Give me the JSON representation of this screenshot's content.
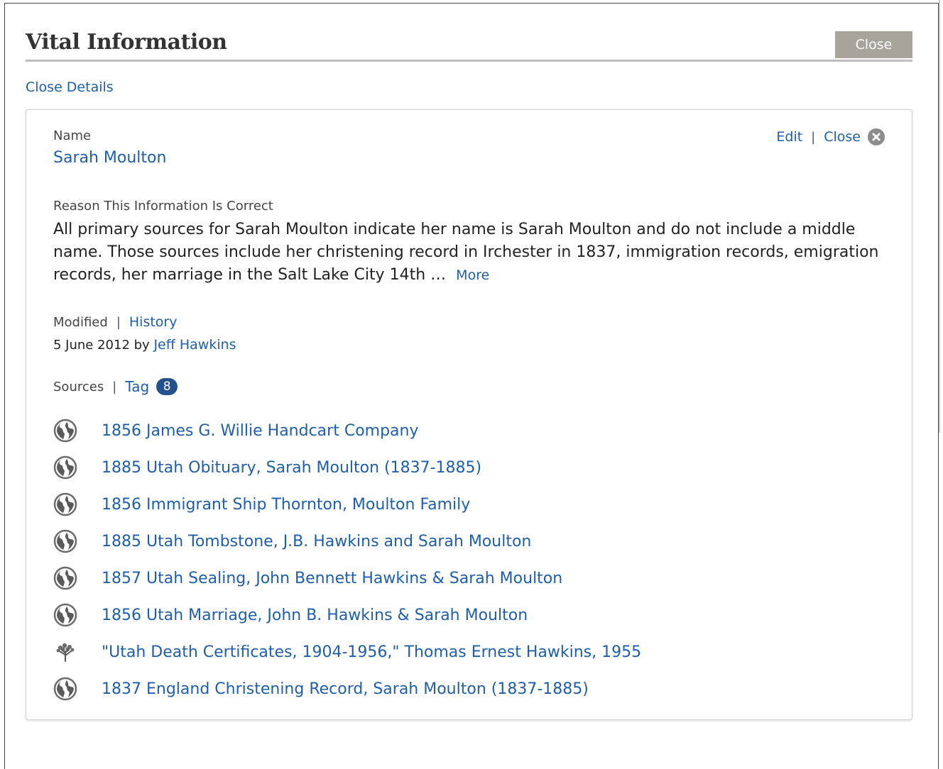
{
  "header": {
    "title": "Vital Information",
    "close_label": "Close"
  },
  "close_details_label": "Close Details",
  "card": {
    "edit_label": "Edit",
    "close_label": "Close",
    "name_label": "Name",
    "name_value": "Sarah Moulton",
    "reason_label": "Reason This Information Is Correct",
    "reason_text": "All primary sources for Sarah Moulton indicate her name is Sarah Moulton and do not include a middle name. Those sources include her christening record in Irchester in 1837, immigration records, emigration records, her marriage in the Salt Lake City 14th …",
    "more_label": "More",
    "modified_label": "Modified",
    "history_label": "History",
    "modified_date": "5 June 2012 by",
    "modified_by": "Jeff Hawkins",
    "sources_label": "Sources",
    "tag_label": "Tag",
    "tag_count": "8",
    "sources": [
      {
        "label": "1856 James G. Willie Handcart Company",
        "icon": "globe-icon"
      },
      {
        "label": "1885 Utah Obituary, Sarah Moulton (1837-1885)",
        "icon": "globe-icon"
      },
      {
        "label": "1856 Immigrant Ship Thornton, Moulton Family",
        "icon": "globe-icon"
      },
      {
        "label": "1885 Utah Tombstone, J.B. Hawkins and Sarah Moulton",
        "icon": "globe-icon"
      },
      {
        "label": "1857 Utah Sealing, John Bennett Hawkins & Sarah Moulton",
        "icon": "globe-icon"
      },
      {
        "label": "1856 Utah Marriage, John B. Hawkins & Sarah Moulton",
        "icon": "globe-icon"
      },
      {
        "label": "\"Utah Death Certificates, 1904-1956,\" Thomas Ernest Hawkins, 1955",
        "icon": "tree-icon"
      },
      {
        "label": "1837 England Christening Record, Sarah Moulton (1837-1885)",
        "icon": "globe-icon"
      }
    ]
  },
  "colors": {
    "link": "#1f5ea8",
    "badge": "#24518d",
    "header_button": "#a8a49b",
    "divider": "#bdbdbd"
  }
}
